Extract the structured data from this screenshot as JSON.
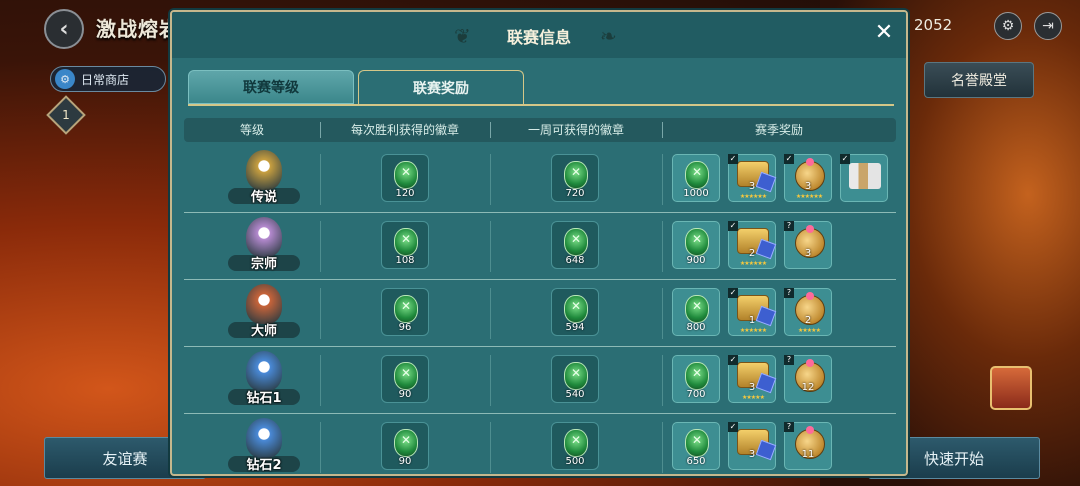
{
  "background": {
    "page_title": "激战熔岩谷",
    "back_icon": "‹",
    "shop_label": "日常商店",
    "shop_icon": "⚙",
    "level_badge": "1",
    "gold_count": "2052",
    "honor_tab": "名誉殿堂",
    "left_bottom_button": "友谊赛",
    "right_bottom_button": "快速开始"
  },
  "modal": {
    "title": "联赛信息",
    "close_icon": "✕",
    "tabs": [
      {
        "label": "联赛等级",
        "active": false
      },
      {
        "label": "联赛奖励",
        "active": true
      }
    ],
    "columns": [
      "等级",
      "每次胜利获得的徽章",
      "一周可获得的徽章",
      "赛季奖励"
    ],
    "rows": [
      {
        "rank": "传说",
        "per_win": "120",
        "per_week": "720",
        "season_badges": "1000",
        "chest_a": {
          "count": "3",
          "mark": "✓",
          "stars": "★★★★★★"
        },
        "chest_b": {
          "count": "3",
          "mark": "✓",
          "stars": "★★★★★★"
        },
        "extra": {
          "mark": "✓"
        }
      },
      {
        "rank": "宗师",
        "per_win": "108",
        "per_week": "648",
        "season_badges": "900",
        "chest_a": {
          "count": "2",
          "mark": "✓",
          "stars": "★★★★★★"
        },
        "chest_b": {
          "count": "3",
          "mark": "?",
          "stars": ""
        }
      },
      {
        "rank": "大师",
        "per_win": "96",
        "per_week": "594",
        "season_badges": "800",
        "chest_a": {
          "count": "1",
          "mark": "✓",
          "stars": "★★★★★★"
        },
        "chest_b": {
          "count": "2",
          "mark": "?",
          "stars": "★★★★★"
        }
      },
      {
        "rank": "钻石1",
        "per_win": "90",
        "per_week": "540",
        "season_badges": "700",
        "chest_a": {
          "count": "3",
          "mark": "✓",
          "stars": "★★★★★"
        },
        "chest_b": {
          "count": "12",
          "mark": "?",
          "stars": ""
        }
      },
      {
        "rank": "钻石2",
        "per_win": "90",
        "per_week": "500",
        "season_badges": "650",
        "chest_a": {
          "count": "3",
          "mark": "✓",
          "stars": ""
        },
        "chest_b": {
          "count": "11",
          "mark": "?",
          "stars": ""
        }
      }
    ]
  },
  "colors": {
    "modal_bg": "#2b6e74",
    "gold_border": "#c5b88d",
    "badge_green": "#1f8a3c"
  },
  "rank_colors": [
    "#c9a040",
    "#b58ad0",
    "#c8643a",
    "#4a8ad8",
    "#4a8ad8"
  ]
}
